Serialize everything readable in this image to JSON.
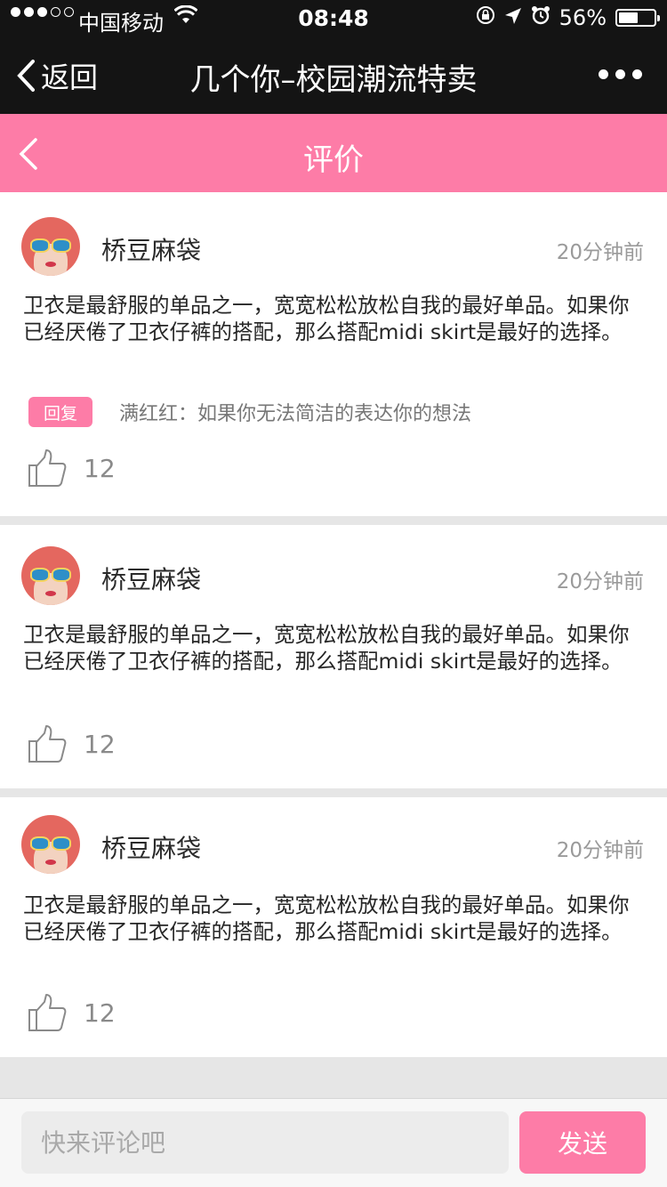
{
  "status_bar": {
    "carrier": "中国移动",
    "time": "08:48",
    "battery": "56%",
    "battery_level": 0.56
  },
  "nav_bar": {
    "back_label": "返回",
    "title": "几个你–校园潮流特卖"
  },
  "page_header": {
    "title": "评价"
  },
  "comments": [
    {
      "username": "桥豆麻袋",
      "time_ago": "20分钟前",
      "content": "卫衣是最舒服的单品之一，宽宽松松放松自我的最好单品。如果你已经厌倦了卫衣仔裤的搭配，那么搭配midi skirt是最好的选择。",
      "reply_badge": "回复",
      "reply_text": "满红红：如果你无法简洁的表达你的想法",
      "likes": "12"
    },
    {
      "username": "桥豆麻袋",
      "time_ago": "20分钟前",
      "content": "卫衣是最舒服的单品之一，宽宽松松放松自我的最好单品。如果你已经厌倦了卫衣仔裤的搭配，那么搭配midi skirt是最好的选择。",
      "likes": "12"
    },
    {
      "username": "桥豆麻袋",
      "time_ago": "20分钟前",
      "content": "卫衣是最舒服的单品之一，宽宽松松放松自我的最好单品。如果你已经厌倦了卫衣仔裤的搭配，那么搭配midi skirt是最好的选择。",
      "likes": "12"
    }
  ],
  "input_bar": {
    "placeholder": "快来评论吧",
    "send_label": "发送"
  },
  "colors": {
    "accent": "#fd7ca7",
    "nav_background": "#141414"
  }
}
